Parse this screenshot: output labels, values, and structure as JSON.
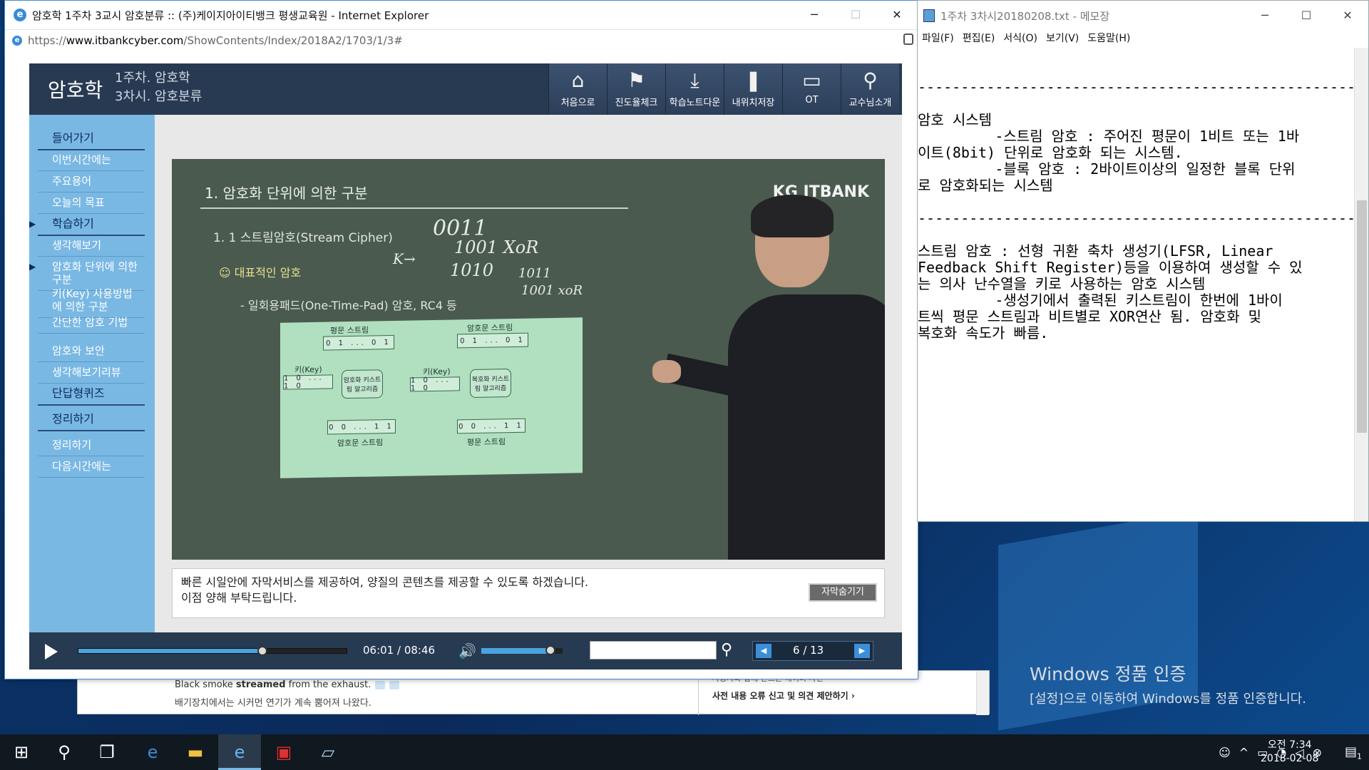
{
  "desktop": {
    "activation_title": "Windows 정품 인증",
    "activation_sub": "[설정]으로 이동하여 Windows를 정품 인증합니다."
  },
  "bg_window": {
    "line1_pre": "Black smoke ",
    "line1_bold": "streamed",
    "line1_post": " from the exhaust.",
    "line2": "배기장치에서는 시커먼 연기가 계속 뿜어져 나왔다.",
    "right1": "사용자와 함께 만드는 네이버 사전",
    "right2": "사전 내용 오류 신고 및 의견 제안하기 ›"
  },
  "ie": {
    "title": "암호학 1주차 3교시 암호분류 :: (주)케이지아이티뱅크 평생교육원 - Internet Explorer",
    "url_scheme": "https://",
    "url_domain": "www.itbankcyber.com",
    "url_path": "/ShowContents/Index/2018A2/1703/1/3#",
    "min": "─",
    "max": "☐",
    "close": "✕"
  },
  "player": {
    "course": "암호학",
    "week": "1주차. 암호학",
    "session": "3차시. 암호분류",
    "nav": [
      {
        "label": "처음으로",
        "icon": "⌂"
      },
      {
        "label": "진도율체크",
        "icon": "⚑"
      },
      {
        "label": "학습노트다운",
        "icon": "⤓"
      },
      {
        "label": "내위치저장",
        "icon": "❚"
      },
      {
        "label": "OT",
        "icon": "▭"
      },
      {
        "label": "교수님소개",
        "icon": "⚲"
      }
    ],
    "sidebar": [
      {
        "label": "들어가기",
        "main": true
      },
      {
        "label": "이번시간에는",
        "main": false
      },
      {
        "label": "주요용어",
        "main": false
      },
      {
        "label": "오늘의 목표",
        "main": false
      },
      {
        "label": "학습하기",
        "main": true
      },
      {
        "label": "생각해보기",
        "main": false
      },
      {
        "label": "암호화 단위에 의한 구분",
        "main": false
      },
      {
        "label": "키(Key) 사용방법에 의한 구분",
        "main": false
      },
      {
        "label": "간단한 암호 기법",
        "main": false
      },
      {
        "label": "암호와 보안",
        "main": false
      },
      {
        "label": "생각해보기리뷰",
        "main": false
      },
      {
        "label": "단답형퀴즈",
        "main": true
      },
      {
        "label": "정리하기",
        "main": true
      },
      {
        "label": "정리하기",
        "main": false
      },
      {
        "label": "다음시간에는",
        "main": false
      }
    ],
    "video": {
      "slide_title": "1. 암호화 단위에 의한 구분",
      "slide_sub": "1. 1 스트림암호(Stream Cipher)",
      "rep": "☺ 대표적인 암호",
      "otp": "- 일회용패드(One-Time-Pad) 암호, RC4 등",
      "logo": "KG ITBANK",
      "d_plain": "평문 스트림",
      "d_key": "키(Key)",
      "d_enc": "암호화 키스트림 알고리즘",
      "d_cipher": "암호문 스트림",
      "d_cipher2": "암호문 스트림",
      "d_key2": "키(Key)",
      "d_dec": "복호화 키스트림 알고리즘",
      "d_plain2": "평문 스트림",
      "bits_a": "0 1 ... 0 1",
      "bits_b": "1 0 ... 1 0",
      "bits_c": "0 0 ... 1 1",
      "chalk1": "0011",
      "chalk2": "1001 XoR",
      "chalk3": "1010",
      "chalk4": "K→",
      "chalk5": "1011",
      "chalk6": "1001 xoR"
    },
    "caption": "빠른 시일안에 자막서비스를 제공하여, 양질의 콘텐츠를 제공할 수 있도록 하겠습니다.\n이점 양해 부탁드립니다.",
    "caption_hide": "자막숨기기",
    "time_current": "06:01",
    "time_total": "08:46",
    "progress": 0.686,
    "volume": 0.85,
    "page_current": "6",
    "page_total": "13"
  },
  "notepad": {
    "title": "1주차 3차시20180208.txt - 메모장",
    "menu": [
      "파일(F)",
      "편집(E)",
      "서식(O)",
      "보기(V)",
      "도움말(H)"
    ],
    "text": "------------------------------------------------------\n\n암호 시스템\n         -스트림 암호 : 주어진 평문이 1비트 또는 1바\n이트(8bit) 단위로 암호화 되는 시스템.\n         -블록 암호 : 2바이트이상의 일정한 블록 단위\n로 암호화되는 시스템\n\n------------------------------------------------------\n\n스트림 암호 : 선형 귀환 축차 생성기(LFSR, Linear\nFeedback Shift Register)등을 이용하여 생성할 수 있\n는 의사 난수열을 키로 사용하는 암호 시스템\n         -생성기에서 출력된 키스트림이 한번에 1바이\n트씩 평문 스트림과 비트별로 XOR연산 됨. 암호화 및\n복호화 속도가 빠름."
  },
  "taskbar": {
    "time": "오전 7:34",
    "date": "2018-02-08",
    "notif": "1"
  }
}
